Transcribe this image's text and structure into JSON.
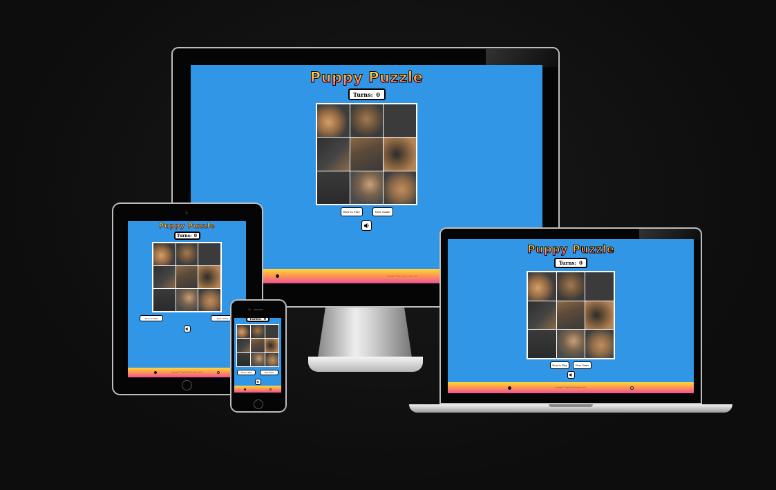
{
  "game": {
    "title": "Puppy Puzzle",
    "turns_label": "Turns:",
    "turns_value": "0",
    "how_to_play_label": "How to Play",
    "new_game_label": "New Game",
    "sound_icon": "speaker-icon",
    "copyright": "Copyright © Puppy Puzzle Developers 2021"
  },
  "tile_order": [
    "t1",
    "t2",
    "blank",
    "t4",
    "t5",
    "t6",
    "t7",
    "t8",
    "t9"
  ],
  "footer": {
    "left_icon": "facebook-icon",
    "right_icon": "instagram-icon"
  },
  "colors": {
    "screen_bg": "#3296e6",
    "title_top": "#fff35c",
    "title_bottom": "#ff5fa8",
    "footer_top": "#ffd83a",
    "footer_bottom": "#f0509a",
    "blank_tile": "#3b3b3b"
  }
}
